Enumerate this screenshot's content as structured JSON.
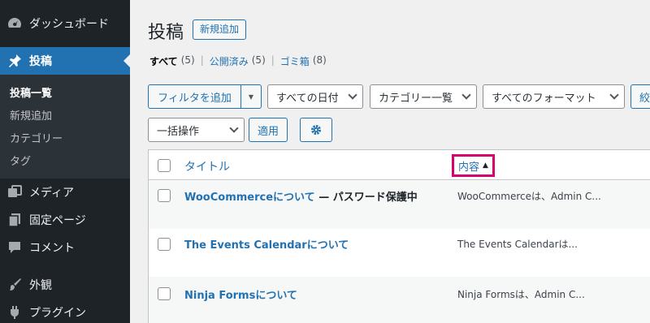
{
  "sidebar": {
    "items": [
      {
        "label": "ダッシュボード",
        "icon": "dashboard-icon"
      },
      {
        "label": "投稿",
        "icon": "pin-icon",
        "active": true
      },
      {
        "label": "メディア",
        "icon": "media-icon"
      },
      {
        "label": "固定ページ",
        "icon": "page-icon"
      },
      {
        "label": "コメント",
        "icon": "comment-icon"
      },
      {
        "label": "外観",
        "icon": "brush-icon"
      },
      {
        "label": "プラグイン",
        "icon": "plugin-icon"
      }
    ],
    "submenu": [
      "投稿一覧",
      "新規追加",
      "カテゴリー",
      "タグ"
    ]
  },
  "header": {
    "title": "投稿",
    "add_new": "新規追加"
  },
  "views": [
    {
      "label": "すべて",
      "count": "(5)"
    },
    {
      "label": "公開済み",
      "count": "(5)"
    },
    {
      "label": "ゴミ箱",
      "count": "(8)"
    }
  ],
  "filters": {
    "add_filter": "フィルタを追加",
    "dates": "すべての日付",
    "categories": "カテゴリー一覧",
    "formats": "すべてのフォーマット",
    "narrow": "絞"
  },
  "bulk": {
    "action": "一括操作",
    "apply": "適用"
  },
  "table": {
    "col_title": "タイトル",
    "col_content": "内容",
    "sort_arrow": "▲",
    "rows": [
      {
        "title": "WooCommerceについて",
        "state": " — パスワード保護中",
        "content": "WooCommerceは、Admin C..."
      },
      {
        "title": "The Events Calendarについて",
        "state": "",
        "content": "The Events Calendarは..."
      },
      {
        "title": "Ninja Formsについて",
        "state": "",
        "content": "Ninja Formsは、Admin C..."
      }
    ]
  },
  "colors": {
    "accent": "#2271b1",
    "sidebar": "#1d2327",
    "highlight": "#d6006e"
  }
}
